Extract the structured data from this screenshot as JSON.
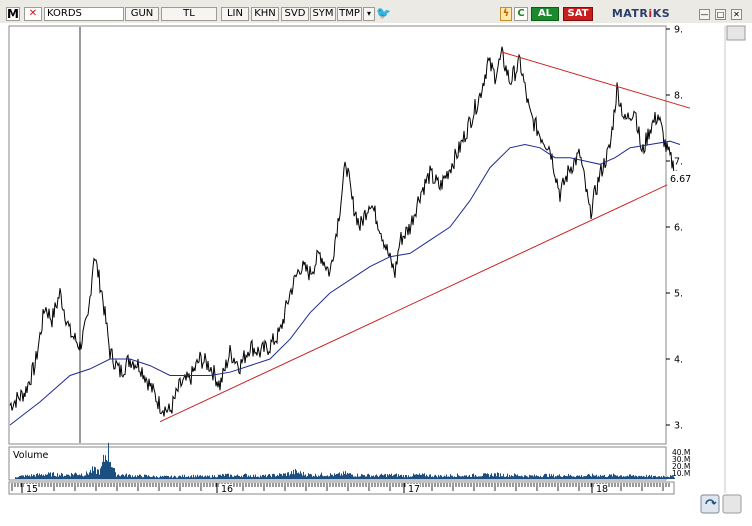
{
  "toolbar": {
    "logo": "M",
    "cancel": "✕",
    "symbol": "KORDS",
    "period": "GUN",
    "currency": "TL",
    "scale": "LIN",
    "khn": "KHN",
    "svd": "SVD",
    "sym": "SYM",
    "tmp": "TMP",
    "dropdown": "▾",
    "twitter": "🐦",
    "bolt": "ϟ",
    "refresh": "C",
    "buy": "AL",
    "sell": "SAT",
    "brand_prefix": "MATR",
    "brand_mid": "i",
    "brand_suffix": "KS",
    "window_min": "—",
    "window_max": "□",
    "window_close": "✕"
  },
  "chart_data": {
    "type": "line",
    "subtype": "price-chart-with-moving-average-trendlines-and-volume",
    "price_axis": {
      "ticks": [
        "9.",
        "8.",
        "7.",
        "6.",
        "5.",
        "4.",
        "3."
      ],
      "ylim": [
        2.9,
        9.05
      ]
    },
    "last_price": "6.67",
    "x_axis": {
      "ticks": [
        "15",
        "16",
        "17",
        "18"
      ]
    },
    "volume_panel": {
      "label": "Volume",
      "ticks": [
        "40.M",
        "30.M",
        "20.M",
        "10.M"
      ]
    },
    "colors": {
      "price": "#000000",
      "moving_average": "#1f2b8f",
      "trendline": "#cc2222",
      "volume": "#1c4f80"
    },
    "price_series": [
      [
        0,
        3.3
      ],
      [
        15,
        3.5
      ],
      [
        25,
        3.9
      ],
      [
        35,
        4.8
      ],
      [
        42,
        4.6
      ],
      [
        50,
        5.0
      ],
      [
        60,
        4.4
      ],
      [
        70,
        4.2
      ],
      [
        78,
        4.6
      ],
      [
        84,
        5.6
      ],
      [
        92,
        5.0
      ],
      [
        100,
        4.1
      ],
      [
        110,
        3.8
      ],
      [
        120,
        4.0
      ],
      [
        130,
        3.9
      ],
      [
        140,
        3.6
      ],
      [
        150,
        3.3
      ],
      [
        160,
        3.2
      ],
      [
        170,
        3.6
      ],
      [
        180,
        3.7
      ],
      [
        190,
        4.0
      ],
      [
        200,
        3.9
      ],
      [
        210,
        3.6
      ],
      [
        220,
        4.1
      ],
      [
        230,
        3.9
      ],
      [
        240,
        4.2
      ],
      [
        250,
        4.1
      ],
      [
        260,
        4.2
      ],
      [
        270,
        4.4
      ],
      [
        280,
        5.0
      ],
      [
        290,
        5.4
      ],
      [
        300,
        5.3
      ],
      [
        310,
        5.6
      ],
      [
        320,
        5.3
      ],
      [
        330,
        6.3
      ],
      [
        336,
        7.0
      ],
      [
        342,
        6.4
      ],
      [
        350,
        6.0
      ],
      [
        360,
        6.4
      ],
      [
        370,
        6.0
      ],
      [
        380,
        5.5
      ],
      [
        385,
        5.3
      ],
      [
        390,
        5.8
      ],
      [
        400,
        6.0
      ],
      [
        410,
        6.5
      ],
      [
        420,
        6.8
      ],
      [
        430,
        6.6
      ],
      [
        440,
        6.9
      ],
      [
        450,
        7.2
      ],
      [
        460,
        7.6
      ],
      [
        470,
        8.0
      ],
      [
        478,
        8.5
      ],
      [
        485,
        8.3
      ],
      [
        492,
        8.6
      ],
      [
        500,
        8.2
      ],
      [
        510,
        8.5
      ],
      [
        520,
        7.7
      ],
      [
        530,
        7.4
      ],
      [
        540,
        7.2
      ],
      [
        550,
        6.5
      ],
      [
        560,
        6.9
      ],
      [
        570,
        7.1
      ],
      [
        580,
        6.2
      ],
      [
        590,
        6.8
      ],
      [
        600,
        7.2
      ],
      [
        607,
        8.1
      ],
      [
        615,
        7.6
      ],
      [
        625,
        7.8
      ],
      [
        632,
        7.1
      ],
      [
        640,
        7.5
      ],
      [
        648,
        7.7
      ],
      [
        656,
        7.2
      ],
      [
        664,
        6.9
      ],
      [
        670,
        6.67
      ]
    ],
    "moving_average": [
      [
        0,
        3.0
      ],
      [
        30,
        3.35
      ],
      [
        60,
        3.75
      ],
      [
        80,
        3.85
      ],
      [
        100,
        4.0
      ],
      [
        120,
        4.0
      ],
      [
        140,
        3.9
      ],
      [
        160,
        3.75
      ],
      [
        180,
        3.75
      ],
      [
        200,
        3.75
      ],
      [
        220,
        3.8
      ],
      [
        240,
        3.9
      ],
      [
        260,
        4.0
      ],
      [
        280,
        4.3
      ],
      [
        300,
        4.7
      ],
      [
        320,
        5.0
      ],
      [
        340,
        5.2
      ],
      [
        360,
        5.4
      ],
      [
        380,
        5.55
      ],
      [
        400,
        5.6
      ],
      [
        420,
        5.8
      ],
      [
        440,
        6.0
      ],
      [
        460,
        6.4
      ],
      [
        480,
        6.9
      ],
      [
        500,
        7.2
      ],
      [
        515,
        7.25
      ],
      [
        530,
        7.2
      ],
      [
        545,
        7.05
      ],
      [
        560,
        7.05
      ],
      [
        575,
        7.0
      ],
      [
        590,
        6.95
      ],
      [
        605,
        7.05
      ],
      [
        620,
        7.2
      ],
      [
        640,
        7.25
      ],
      [
        660,
        7.3
      ],
      [
        670,
        7.25
      ]
    ],
    "trendlines": [
      {
        "from": [
          150,
          3.05
        ],
        "to": [
          680,
          6.8
        ]
      },
      {
        "from": [
          492,
          8.65
        ],
        "to": [
          680,
          7.8
        ]
      }
    ],
    "volume": [
      [
        5,
        3
      ],
      [
        15,
        4
      ],
      [
        25,
        5
      ],
      [
        35,
        6
      ],
      [
        45,
        6
      ],
      [
        55,
        5
      ],
      [
        65,
        7
      ],
      [
        75,
        6
      ],
      [
        82,
        11
      ],
      [
        90,
        10
      ],
      [
        97,
        38
      ],
      [
        105,
        6
      ],
      [
        115,
        5
      ],
      [
        125,
        4
      ],
      [
        135,
        4
      ],
      [
        145,
        3
      ],
      [
        155,
        3
      ],
      [
        165,
        3
      ],
      [
        175,
        4
      ],
      [
        185,
        4
      ],
      [
        195,
        3
      ],
      [
        205,
        4
      ],
      [
        215,
        5
      ],
      [
        225,
        4
      ],
      [
        235,
        5
      ],
      [
        245,
        4
      ],
      [
        255,
        4
      ],
      [
        265,
        5
      ],
      [
        275,
        6
      ],
      [
        285,
        9
      ],
      [
        295,
        6
      ],
      [
        305,
        5
      ],
      [
        315,
        6
      ],
      [
        325,
        5
      ],
      [
        335,
        7
      ],
      [
        345,
        5
      ],
      [
        355,
        5
      ],
      [
        365,
        4
      ],
      [
        375,
        5
      ],
      [
        385,
        5
      ],
      [
        395,
        4
      ],
      [
        405,
        5
      ],
      [
        415,
        5
      ],
      [
        425,
        4
      ],
      [
        435,
        4
      ],
      [
        445,
        5
      ],
      [
        455,
        4
      ],
      [
        465,
        5
      ],
      [
        475,
        5
      ],
      [
        485,
        6
      ],
      [
        495,
        5
      ],
      [
        505,
        5
      ],
      [
        515,
        4
      ],
      [
        525,
        4
      ],
      [
        535,
        5
      ],
      [
        545,
        4
      ],
      [
        555,
        5
      ],
      [
        565,
        4
      ],
      [
        575,
        4
      ],
      [
        585,
        5
      ],
      [
        595,
        4
      ],
      [
        605,
        5
      ],
      [
        615,
        4
      ],
      [
        625,
        4
      ],
      [
        635,
        4
      ],
      [
        645,
        3
      ],
      [
        655,
        4
      ],
      [
        665,
        3
      ]
    ]
  }
}
